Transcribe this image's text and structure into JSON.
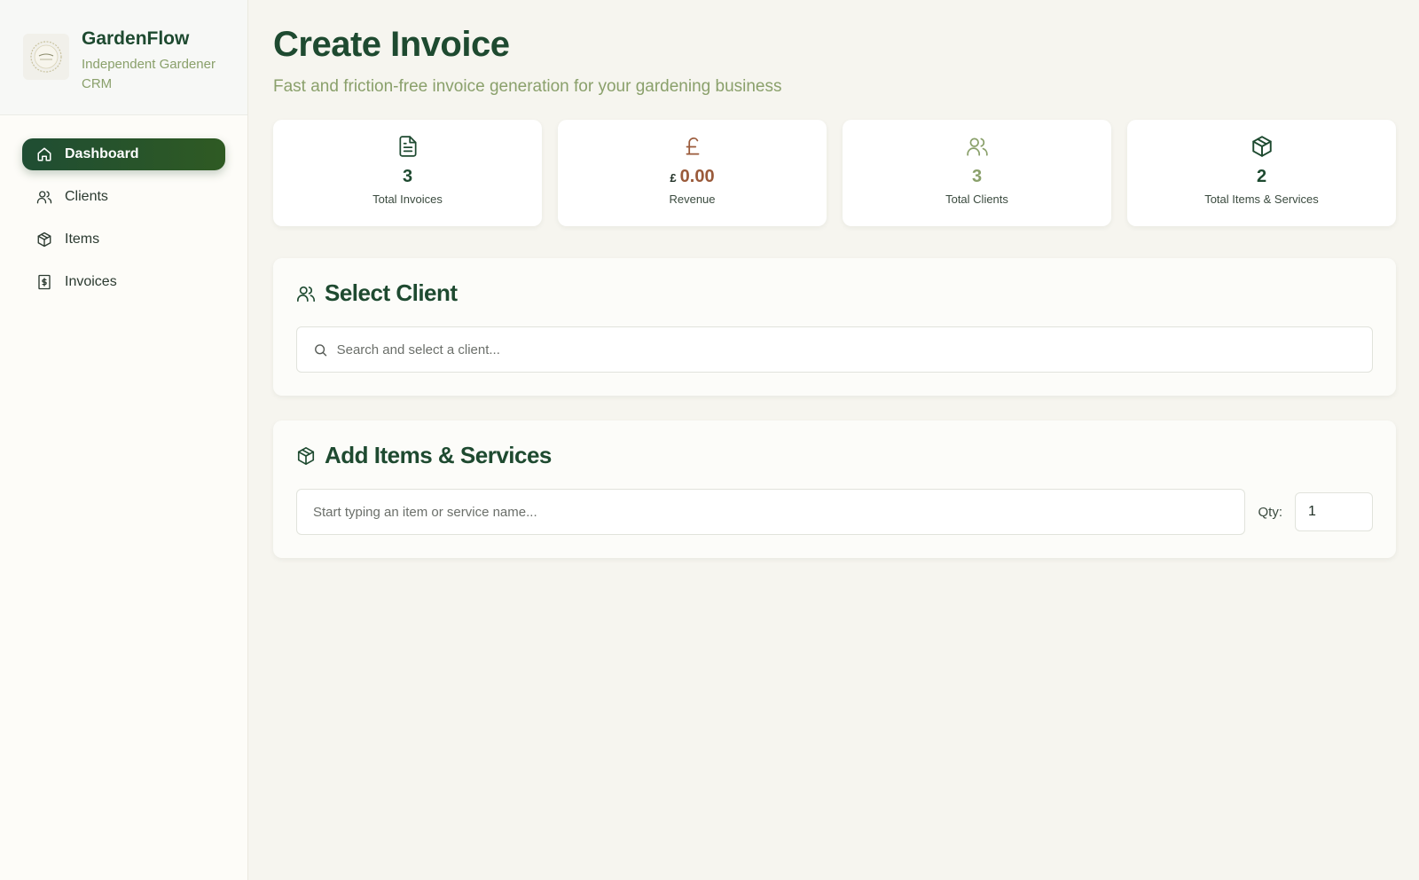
{
  "brand": {
    "name": "GardenFlow",
    "subtitle": "Independent Gardener CRM",
    "logo_icon": "garden-logo-icon"
  },
  "nav": {
    "items": [
      {
        "label": "Dashboard",
        "icon": "home-icon",
        "active": true
      },
      {
        "label": "Clients",
        "icon": "users-icon",
        "active": false
      },
      {
        "label": "Items",
        "icon": "box-icon",
        "active": false
      },
      {
        "label": "Invoices",
        "icon": "receipt-icon",
        "active": false
      }
    ]
  },
  "header": {
    "title": "Create Invoice",
    "subtitle": "Fast and friction-free invoice generation for your gardening business"
  },
  "stats": [
    {
      "value": "3",
      "label": "Total Invoices",
      "icon": "file-text-icon",
      "color": "#1e4a30"
    },
    {
      "currency": "£",
      "value": "0.00",
      "label": "Revenue",
      "icon": "pound-icon",
      "color": "#9a5a3a"
    },
    {
      "value": "3",
      "label": "Total Clients",
      "icon": "users-icon",
      "color": "#8aa06b"
    },
    {
      "value": "2",
      "label": "Total Items & Services",
      "icon": "box-icon",
      "color": "#1e4a30"
    }
  ],
  "select_client": {
    "title": "Select Client",
    "placeholder": "Search and select a client..."
  },
  "add_items": {
    "title": "Add Items & Services",
    "placeholder": "Start typing an item or service name...",
    "qty_label": "Qty:",
    "qty_value": "1"
  },
  "colors": {
    "primary": "#1e4a30",
    "accent_green": "#8aa06b",
    "revenue_brown": "#9a5a3a",
    "background": "#f6f5ef"
  }
}
